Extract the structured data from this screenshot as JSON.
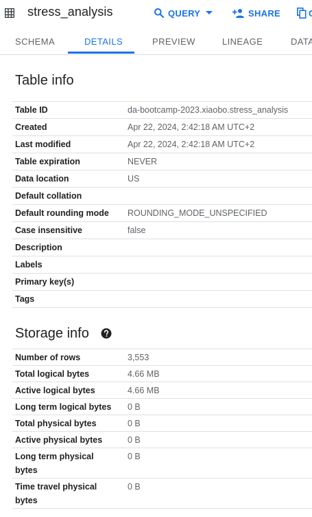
{
  "header": {
    "title": "stress_analysis",
    "query_label": "QUERY",
    "share_label": "SHARE",
    "copy_partial": "C"
  },
  "tabs": [
    "SCHEMA",
    "DETAILS",
    "PREVIEW",
    "LINEAGE",
    "DATA"
  ],
  "active_tab": "DETAILS",
  "table_info": {
    "heading": "Table info",
    "rows": [
      {
        "key": "Table ID",
        "value": "da-bootcamp-2023.xiaobo.stress_analysis"
      },
      {
        "key": "Created",
        "value": "Apr 22, 2024, 2:42:18 AM UTC+2"
      },
      {
        "key": "Last modified",
        "value": "Apr 22, 2024, 2:42:18 AM UTC+2"
      },
      {
        "key": "Table expiration",
        "value": "NEVER"
      },
      {
        "key": "Data location",
        "value": "US"
      },
      {
        "key": "Default collation",
        "value": ""
      },
      {
        "key": "Default rounding mode",
        "value": "ROUNDING_MODE_UNSPECIFIED"
      },
      {
        "key": "Case insensitive",
        "value": "false"
      },
      {
        "key": "Description",
        "value": ""
      },
      {
        "key": "Labels",
        "value": ""
      },
      {
        "key": "Primary key(s)",
        "value": ""
      },
      {
        "key": "Tags",
        "value": ""
      }
    ]
  },
  "storage_info": {
    "heading": "Storage info",
    "help_icon": "help-circle-icon",
    "rows": [
      {
        "key": "Number of rows",
        "value": "3,553"
      },
      {
        "key": "Total logical bytes",
        "value": "4.66 MB"
      },
      {
        "key": "Active logical bytes",
        "value": "4.66 MB"
      },
      {
        "key": "Long term logical bytes",
        "value": "0 B"
      },
      {
        "key": "Total physical bytes",
        "value": "0 B"
      },
      {
        "key": "Active physical bytes",
        "value": "0 B"
      },
      {
        "key": "Long term physical bytes",
        "value": "0 B"
      },
      {
        "key": "Time travel physical bytes",
        "value": "0 B"
      }
    ]
  },
  "colors": {
    "accent": "#1a73e8",
    "text": "#202124",
    "muted": "#5f6368",
    "divider": "#e0e0e0"
  }
}
